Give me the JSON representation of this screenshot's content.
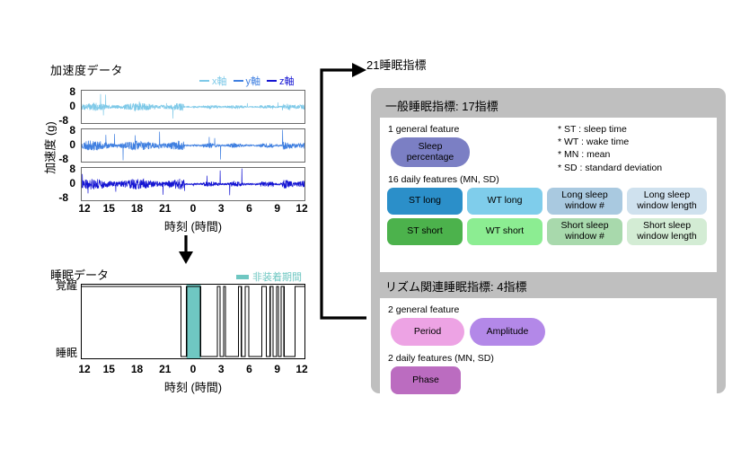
{
  "accel": {
    "title": "加速度データ",
    "y_axis_label": "加速度 (g)",
    "x_axis_label": "時刻 (時間)",
    "y_ticks": [
      "8",
      "0",
      "-8"
    ],
    "x_ticks": [
      "12",
      "15",
      "18",
      "21",
      "0",
      "3",
      "6",
      "9",
      "12"
    ],
    "legend": [
      {
        "label": "x軸",
        "color": "#7ec9e8"
      },
      {
        "label": "y軸",
        "color": "#3f7fe0"
      },
      {
        "label": "z軸",
        "color": "#1414d2"
      }
    ]
  },
  "sleep": {
    "title": "睡眠データ",
    "x_axis_label": "時刻 (時間)",
    "y_ticks": [
      "覚醒",
      "睡眠"
    ],
    "x_ticks": [
      "12",
      "15",
      "18",
      "21",
      "0",
      "3",
      "6",
      "9",
      "12"
    ],
    "legend": {
      "label": "非装着期間",
      "color": "#6fc7c2"
    }
  },
  "indicators": {
    "title": "21睡眠指標",
    "general": {
      "heading": "一般睡眠指標: 17指標",
      "general_feature_label": "1 general feature",
      "sleep_percentage": {
        "label": "Sleep percentage",
        "color": "#7b7fc4"
      },
      "abbreviations": [
        "* ST : sleep time",
        "* WT : wake time",
        "* MN : mean",
        "* SD : standard deviation"
      ],
      "daily_feature_label": "16 daily features (MN, SD)",
      "daily_features": [
        {
          "label": "ST long",
          "color": "#2b8fc9"
        },
        {
          "label": "WT long",
          "color": "#7fcdeb"
        },
        {
          "label": "Long sleep window #",
          "color": "#a9c9e0"
        },
        {
          "label": "Long sleep window length",
          "color": "#cfe1ee"
        },
        {
          "label": "ST short",
          "color": "#4cb24c"
        },
        {
          "label": "WT short",
          "color": "#8ced92"
        },
        {
          "label": "Short sleep window #",
          "color": "#a8d9ac"
        },
        {
          "label": "Short sleep window length",
          "color": "#d3ecd4"
        }
      ]
    },
    "rhythm": {
      "heading": "リズム関連睡眠指標: 4指標",
      "general_feature_label": "2 general feature",
      "general_features": [
        {
          "label": "Period",
          "color": "#eda3e4"
        },
        {
          "label": "Amplitude",
          "color": "#b388e8"
        }
      ],
      "daily_feature_label": "2 daily features (MN, SD)",
      "daily_features": [
        {
          "label": "Phase",
          "color": "#bb6cc0"
        }
      ]
    }
  },
  "chart_data": [
    {
      "type": "line",
      "title": "加速度データ",
      "xlabel": "時刻 (時間)",
      "ylabel": "加速度 (g)",
      "xlim": [
        12,
        36
      ],
      "ylim": [
        -8,
        8
      ],
      "xtick_labels": [
        "12",
        "15",
        "18",
        "21",
        "0",
        "3",
        "6",
        "9",
        "12"
      ],
      "ytick_labels": [
        "8",
        "0",
        "-8"
      ],
      "grid": false,
      "legend_position": "top-right",
      "series": [
        {
          "name": "x軸",
          "color": "#7ec9e8",
          "description": "tri-axial accelerometer x-axis, noisy signal around 0 g, spikes to ±6 g"
        },
        {
          "name": "y軸",
          "color": "#3f7fe0",
          "description": "tri-axial accelerometer y-axis, noisy signal around 0 g, spikes to ±8 g"
        },
        {
          "name": "z軸",
          "color": "#1414d2",
          "description": "tri-axial accelerometer z-axis, noisy signal around 0 g, spikes to ±8 g"
        }
      ]
    },
    {
      "type": "line",
      "title": "睡眠データ",
      "xlabel": "時刻 (時間)",
      "ylabel": "",
      "xlim": [
        12,
        36
      ],
      "ytick_labels": [
        "覚醒",
        "睡眠"
      ],
      "grid": false,
      "legend_position": "top-right",
      "annotations": [
        {
          "label": "非装着期間",
          "color": "#6fc7c2",
          "x_start": 23.3,
          "x_end": 24.8
        }
      ],
      "sleep_intervals": [
        [
          22.7,
          23.3
        ],
        [
          24.8,
          26.6
        ],
        [
          26.9,
          27.3
        ],
        [
          27.5,
          28.9
        ],
        [
          29.2,
          29.6
        ],
        [
          30.0,
          31.4
        ],
        [
          31.9,
          32.3
        ],
        [
          32.6,
          33.0
        ],
        [
          33.2,
          33.5
        ],
        [
          33.8,
          35.0
        ]
      ]
    }
  ]
}
